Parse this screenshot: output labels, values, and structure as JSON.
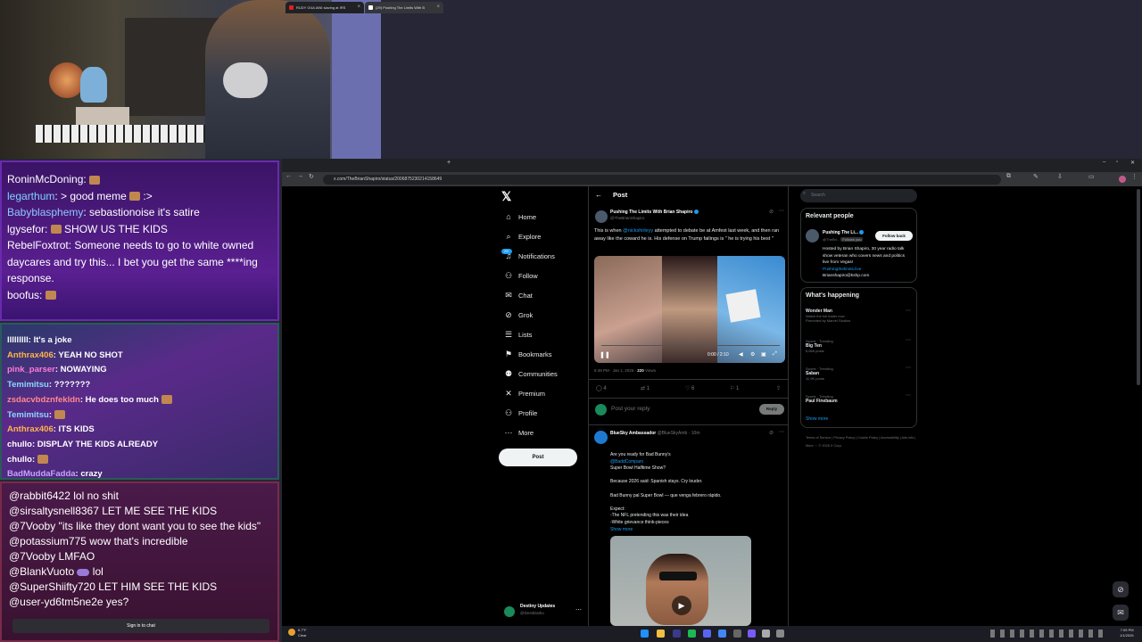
{
  "chat_top": [
    {
      "user": "RoninMcDoning",
      "color": "#ffffff",
      "text": ""
    },
    {
      "user": "legarthum",
      "color": "#7fd3ff",
      "text": ": > good meme ",
      "tail": " :>"
    },
    {
      "user": "Babyblasphemy",
      "color": "#8fc8ff",
      "text": ": sebastionoise it's satire"
    },
    {
      "user": "lgysefor",
      "color": "#ffffff",
      "text": ": ",
      "tail": " SHOW US THE KIDS"
    },
    {
      "user": "RebelFoxtrot",
      "color": "#ffffff",
      "text": ": Someone needs to go to white owned daycares and try this... I bet you get the same ****ing response."
    },
    {
      "user": "boofus",
      "color": "#ffffff",
      "text": ": "
    }
  ],
  "chat_mid": [
    {
      "user": "lllllllll",
      "color": "#ffffff",
      "text": ": It's a joke"
    },
    {
      "user": "Anthrax406",
      "color": "#ffb44a",
      "text": ": YEAH NO SHOT"
    },
    {
      "user": "pink_parser",
      "color": "#ff7ad8",
      "text": ": NOWAYING"
    },
    {
      "user": "Temimitsu",
      "color": "#8ad8ff",
      "text": ": ???????"
    },
    {
      "user": "zsdacvbdznfekldn",
      "color": "#ff8a8a",
      "text": ": He does too much"
    },
    {
      "user": "Temimitsu",
      "color": "#8ad8ff",
      "text": ": "
    },
    {
      "user": "Anthrax406",
      "color": "#ffb44a",
      "text": ": ITS KIDS"
    },
    {
      "user": "chullo",
      "color": "#ffffff",
      "text": ": DISPLAY THE KIDS ALREADY"
    },
    {
      "user": "chullo",
      "color": "#ffffff",
      "text": ": "
    },
    {
      "user": "BadMuddaFadda",
      "color": "#c9a0ff",
      "text": ": crazy"
    }
  ],
  "chat_bottom": [
    {
      "user": "@rabbit6422",
      "text": " lol no shit"
    },
    {
      "user": "@sirsaltysnell8367",
      "text": " LET ME SEE THE KIDS"
    },
    {
      "user": "@7Vooby",
      "text": " \"its like they dont want you to see the kids\""
    },
    {
      "user": "@potassium775",
      "text": " wow that's incredible"
    },
    {
      "user": "@7Vooby",
      "text": " LMFAO"
    },
    {
      "user": "@BlankVuoto",
      "text": " lol"
    },
    {
      "user": "@SuperShiifty720",
      "text": " LET HIM SEE THE KIDS"
    },
    {
      "user": "@user-yd6tm5ne2e",
      "text": " yes?"
    }
  ],
  "signin_label": "Sign in to chat",
  "browser": {
    "tab1": "RUDY GIULIANI slaving at IRS",
    "tab2": "(29) Pushing The Limits With B",
    "url": "x.com/TheBrianShapiro/status/2006875230214158649"
  },
  "x_nav": [
    {
      "icon": "home-icon",
      "glyph": "⌂",
      "label": "Home"
    },
    {
      "icon": "explore-icon",
      "glyph": "⌕",
      "label": "Explore"
    },
    {
      "icon": "notifications-icon",
      "glyph": "♫",
      "label": "Notifications"
    },
    {
      "icon": "follow-icon",
      "glyph": "⚇",
      "label": "Follow"
    },
    {
      "icon": "chat-icon",
      "glyph": "✉",
      "label": "Chat"
    },
    {
      "icon": "grok-icon",
      "glyph": "⊘",
      "label": "Grok"
    },
    {
      "icon": "lists-icon",
      "glyph": "☰",
      "label": "Lists"
    },
    {
      "icon": "bookmarks-icon",
      "glyph": "⚑",
      "label": "Bookmarks"
    },
    {
      "icon": "communities-icon",
      "glyph": "⚉",
      "label": "Communities"
    },
    {
      "icon": "premium-icon",
      "glyph": "✕",
      "label": "Premium"
    },
    {
      "icon": "profile-icon",
      "glyph": "⚇",
      "label": "Profile"
    },
    {
      "icon": "more-icon",
      "glyph": "⋯",
      "label": "More"
    }
  ],
  "notif_badge": "20+",
  "post_button": "Post",
  "account": {
    "name": "Destiny Updates",
    "handle": "@DestiDarko"
  },
  "post": {
    "header": "Post",
    "author": "Pushing The Limits With Brian Shapiro",
    "handle": "@TheBrianShapiro",
    "text_a": "This is when ",
    "mention": "@nickshirleyy",
    "text_b": " attempted to debate be at Amfest last week, and then ran away like the coward he is. His defense on Trump failings is \" he is trying his best \"",
    "video_time": "0:00 / 2:10",
    "time": "6:48 PM · Jan 1, 2026 · ",
    "views": "220",
    "views_label": " Views",
    "replies": "4",
    "reposts": "1",
    "likes": "6",
    "bookmarks": "1",
    "reply_placeholder": "Post your reply",
    "reply_button": "Reply"
  },
  "reply": {
    "author": "BlueSky Ambassador",
    "handle": "@BlueSkyAmb · 10m",
    "line1": "Are you ready for Bad Bunny's",
    "mention": "@BaddCompani",
    "line2": "Super Bowl Halftime Show?",
    "p2": "Because 2026 said: Spanish stays. Cry louder.",
    "p3": "Bad Bunny pal Super Bowl — que venga febrero rápido.",
    "p4a": "Expect:",
    "p4b": "-The NFL pretending this was their idea",
    "p4c": "-White grievance think-pieces",
    "show_more": "Show more"
  },
  "right": {
    "search_placeholder": "Search",
    "relevant_title": "Relevant people",
    "person_name": "Pushing The Li...",
    "person_handle": "@TheBri...",
    "follows_you": "Follows you",
    "follow_back": "Follow back",
    "bio": "Hosted by Brian Shapiro, 30 year radio talk show veteran who covers news and politics live from Vegas!",
    "bio_link": "Pushingthelimits.live",
    "bio_email": "Brianshapiro@kshp.com",
    "happening_title": "What's happening",
    "trends": [
      {
        "cat": "",
        "name": "Wonder Man",
        "sub": "Watch the full trailer now",
        "promo": "Promoted by Marvel Studios"
      },
      {
        "cat": "Sports · Trending",
        "name": "Big Ten",
        "sub": "6,666 posts",
        "promo": ""
      },
      {
        "cat": "Sports · Trending",
        "name": "Saban",
        "sub": "11.9K posts",
        "promo": ""
      },
      {
        "cat": "Sports · Trending",
        "name": "Paul Finebaum",
        "sub": "",
        "promo": ""
      }
    ],
    "show_more": "Show more",
    "footer": "Terms of Service  |  Privacy Policy  |  Cookie Policy  |  Accessibility  |  Ads info  |  More ···  © 2026 X Corp."
  },
  "taskbar": {
    "temp": "6.7°F",
    "weather": "Clear",
    "time": "7:05 PM",
    "date": "1/1/2026"
  }
}
